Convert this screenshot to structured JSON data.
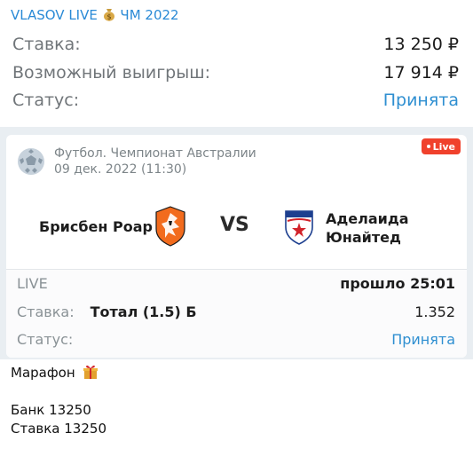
{
  "header": {
    "channel_name": "VLASOV LIVE",
    "channel_suffix": "ЧМ 2022",
    "bag_icon": "money-bag-icon"
  },
  "bet_summary": {
    "stake_label": "Ставка:",
    "stake_value": "13 250 ₽",
    "payout_label": "Возможный выигрыш:",
    "payout_value": "17 914 ₽",
    "status_label": "Статус:",
    "status_value": "Принята"
  },
  "match": {
    "league": "Футбол. Чемпионат Австралии",
    "date": "09 дек. 2022 (11:30)",
    "live_badge": "Live",
    "home_team": "Брисбен Роар",
    "vs": "VS",
    "away_team_line1": "Аделаида",
    "away_team_line2": "Юнайтед",
    "state_label": "LIVE",
    "elapsed": "прошло 25:01",
    "bet_label": "Ставка:",
    "bet_market": "Тотал (1.5) Б",
    "odds": "1.352",
    "status_label": "Статус:",
    "status_value": "Принята"
  },
  "message": {
    "line1": "Марафон",
    "line2": "Банк 13250",
    "line3": "Ставка 13250",
    "gift_icon": "gift-icon"
  },
  "colors": {
    "link_blue": "#2f8fd1",
    "live_red": "#f0412c",
    "band_gray": "#e9eef2"
  }
}
